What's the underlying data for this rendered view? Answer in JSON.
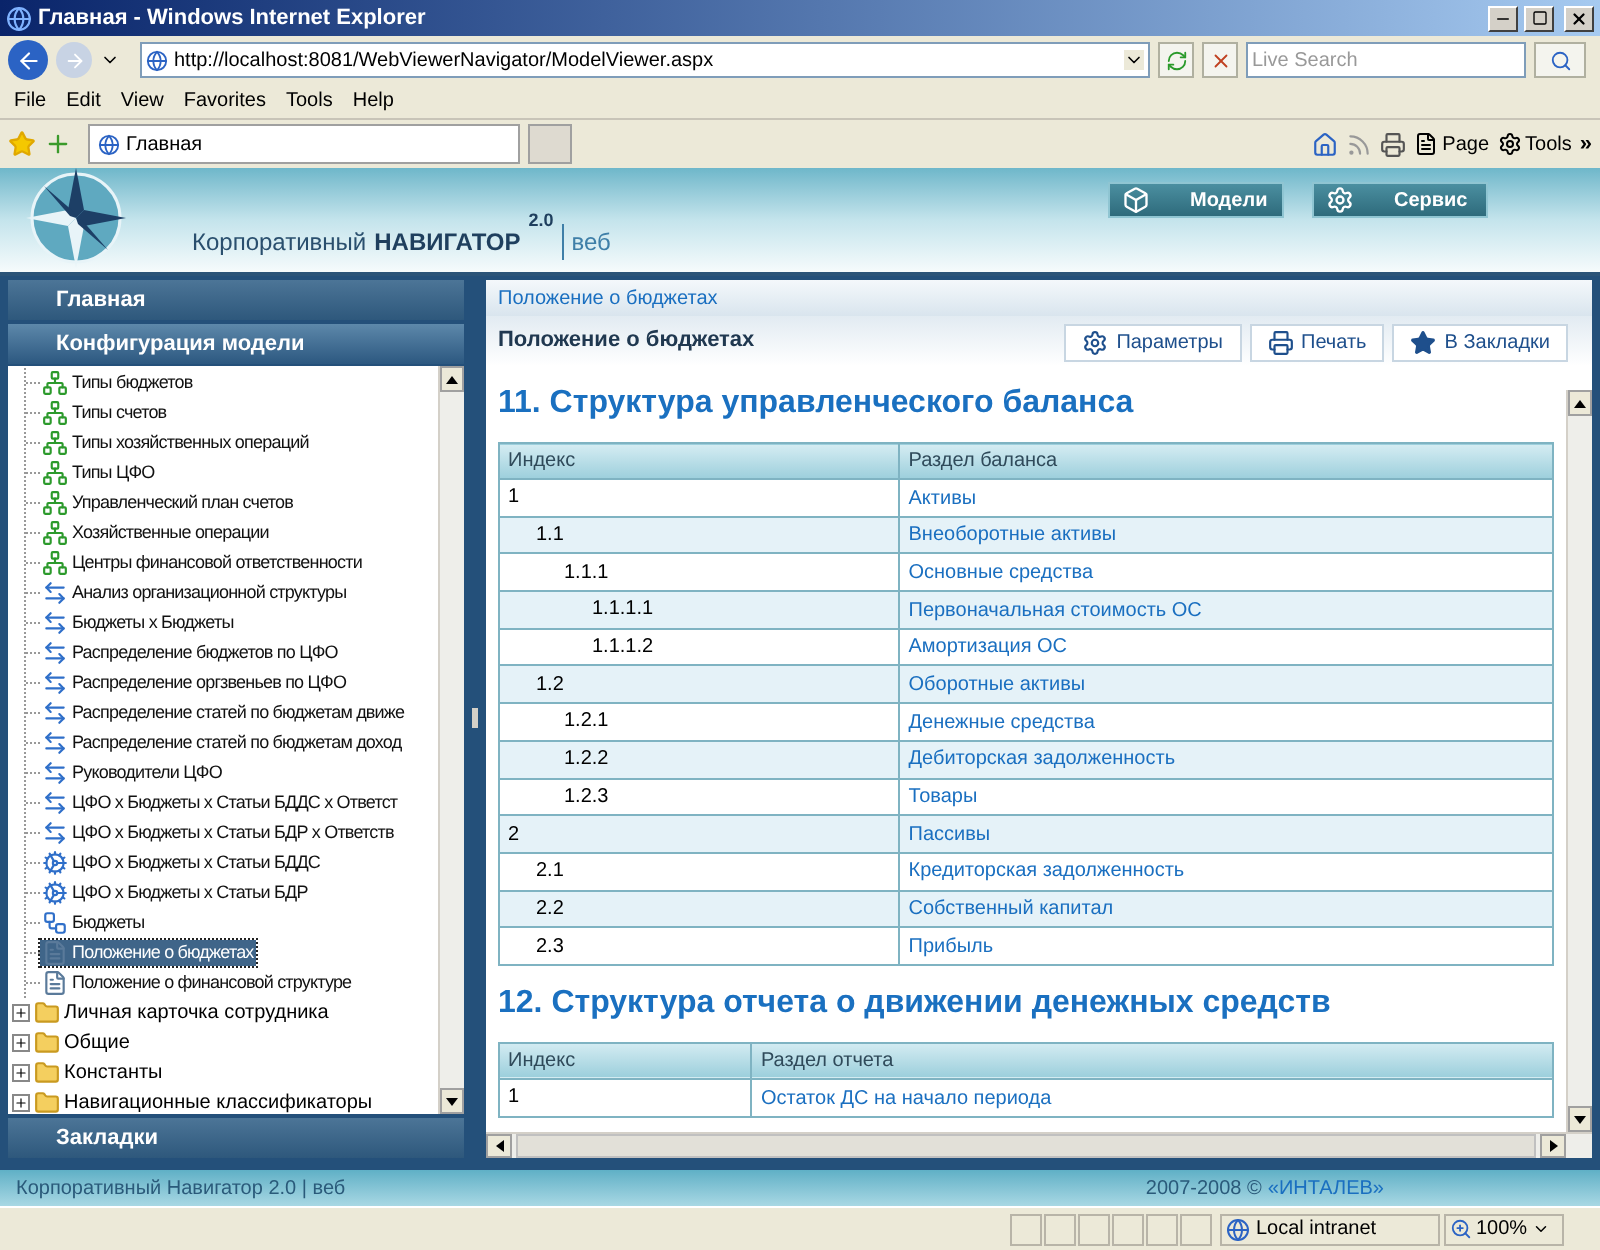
{
  "browser": {
    "title": "Главная - Windows Internet Explorer",
    "address": "http://localhost:8081/WebViewerNavigator/ModelViewer.aspx",
    "search": {
      "placeholder": "Live Search"
    },
    "menu": [
      "File",
      "Edit",
      "View",
      "Favorites",
      "Tools",
      "Help"
    ],
    "tab": "Главная",
    "toolbar": [
      "Page",
      "Tools"
    ],
    "chevron": "»"
  },
  "header": {
    "brand": "Корпоративный",
    "product": "НАВИГАТОР",
    "version": "2.0",
    "edition": "веб",
    "nav": [
      {
        "label": "Модели",
        "kind": "cube"
      },
      {
        "label": "Сервис",
        "kind": "gear"
      }
    ]
  },
  "sidebar": {
    "sections": [
      {
        "label": "Главная",
        "expanded": false
      },
      {
        "label": "Конфигурация модели",
        "expanded": true
      },
      {
        "label": "Закладки",
        "expanded": false
      }
    ],
    "tree_items": [
      {
        "label": "Типы бюджетов",
        "kind": "hierarchy",
        "selected": false
      },
      {
        "label": "Типы счетов",
        "kind": "hierarchy",
        "selected": false
      },
      {
        "label": "Типы хозяйственных операций",
        "kind": "hierarchy",
        "selected": false
      },
      {
        "label": "Типы ЦФО",
        "kind": "hierarchy",
        "selected": false
      },
      {
        "label": "Управленческий план счетов",
        "kind": "hierarchy",
        "selected": false
      },
      {
        "label": "Хозяйственные операции",
        "kind": "hierarchy",
        "selected": false
      },
      {
        "label": "Центры финансовой ответственности",
        "kind": "hierarchy",
        "selected": false
      },
      {
        "label": "Анализ организационной структуры",
        "kind": "link",
        "selected": false
      },
      {
        "label": "Бюджеты x Бюджеты",
        "kind": "link",
        "selected": false
      },
      {
        "label": "Распределение бюджетов по ЦФО",
        "kind": "link",
        "selected": false
      },
      {
        "label": "Распределение оргзвеньев по ЦФО",
        "kind": "link",
        "selected": false
      },
      {
        "label": "Распределение статей по бюджетам движе",
        "kind": "link",
        "selected": false
      },
      {
        "label": "Распределение статей по бюджетам доход",
        "kind": "link",
        "selected": false
      },
      {
        "label": "Руководители ЦФО",
        "kind": "link",
        "selected": false
      },
      {
        "label": "ЦФО x Бюджеты x Статьи БДДС x Ответст",
        "kind": "link",
        "selected": false
      },
      {
        "label": "ЦФО x Бюджеты x Статьи БДР x Ответств",
        "kind": "link",
        "selected": false
      },
      {
        "label": "ЦФО x Бюджеты x Статьи БДДС",
        "kind": "cube",
        "selected": false
      },
      {
        "label": "ЦФО x Бюджеты x Статьи БДР",
        "kind": "cube",
        "selected": false
      },
      {
        "label": "Бюджеты",
        "kind": "budget",
        "selected": false
      },
      {
        "label": "Положение о бюджетах",
        "kind": "report",
        "selected": true
      },
      {
        "label": "Положение о финансовой структуре",
        "kind": "report",
        "selected": false
      }
    ],
    "folders": [
      {
        "label": "Личная карточка сотрудника",
        "expanded": false
      },
      {
        "label": "Общие",
        "expanded": false
      },
      {
        "label": "Константы",
        "expanded": false
      },
      {
        "label": "Навигационные классификаторы",
        "expanded": false
      }
    ]
  },
  "breadcrumb": "Положение о бюджетах",
  "page": {
    "title": "Положение о бюджетах",
    "actions": [
      {
        "label": "Параметры",
        "kind": "settings"
      },
      {
        "label": "Печать",
        "kind": "print"
      },
      {
        "label": "В Закладки",
        "kind": "bookmark"
      }
    ],
    "sections": [
      {
        "heading": "11. Структура управленческого баланса",
        "columns": [
          "Индекс",
          "Раздел баланса"
        ],
        "rows": [
          {
            "index": "1",
            "name": "Активы",
            "children": [
              {
                "index": "1.1",
                "name": "Внеоборотные активы",
                "children": [
                  {
                    "index": "1.1.1",
                    "name": "Основные средства",
                    "children": [
                      {
                        "index": "1.1.1.1",
                        "name": "Первоначальная стоимость ОС"
                      },
                      {
                        "index": "1.1.1.2",
                        "name": "Амортизация ОС"
                      }
                    ]
                  }
                ]
              },
              {
                "index": "1.2",
                "name": "Оборотные активы",
                "children": [
                  {
                    "index": "1.2.1",
                    "name": "Денежные средства"
                  },
                  {
                    "index": "1.2.2",
                    "name": "Дебиторская задолженность"
                  },
                  {
                    "index": "1.2.3",
                    "name": "Товары"
                  }
                ]
              }
            ]
          },
          {
            "index": "2",
            "name": "Пассивы",
            "children": [
              {
                "index": "2.1",
                "name": "Кредиторская задолженность"
              },
              {
                "index": "2.2",
                "name": "Собственный капитал"
              },
              {
                "index": "2.3",
                "name": "Прибыль"
              }
            ]
          }
        ]
      },
      {
        "heading": "12. Структура отчета о движении денежных средств",
        "columns": [
          "Индекс",
          "Раздел отчета"
        ],
        "rows": [
          {
            "index": "1",
            "name": "Остаток ДС на начало периода"
          }
        ]
      }
    ]
  },
  "footer": {
    "left": "Корпоративный Навигатор 2.0 | веб",
    "copyright": "2007-2008 ©",
    "company": "«ИНТАЛЕВ»"
  },
  "status_bar": {
    "zone": "Local intranet",
    "zoom": "100%"
  }
}
